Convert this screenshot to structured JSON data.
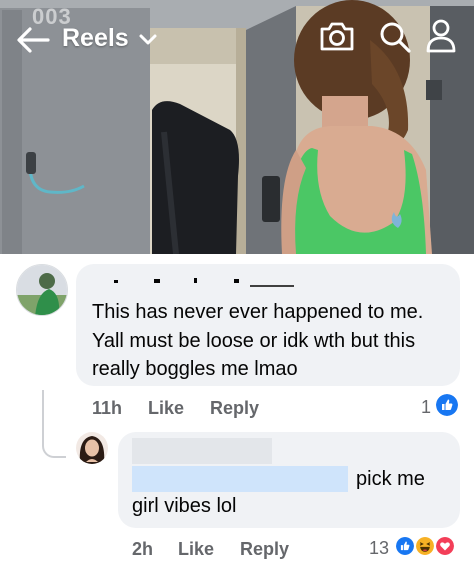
{
  "overlay": {
    "watermark": "003"
  },
  "header": {
    "title": "Reels",
    "icons": [
      "back-arrow-icon",
      "chevron-down-icon",
      "camera-icon",
      "search-icon",
      "profile-icon"
    ]
  },
  "comments": [
    {
      "text": "This has never ever happened to me. Yall must be loose or idk wth but this really boggles me lmao",
      "time": "11h",
      "like_label": "Like",
      "reply_label": "Reply",
      "reaction_count": "1",
      "reactions": [
        "like-reaction-icon"
      ]
    },
    {
      "text_line1": "pick me",
      "text_line2": "girl vibes lol",
      "time": "2h",
      "like_label": "Like",
      "reply_label": "Reply",
      "reaction_count": "13",
      "reactions": [
        "like-reaction-icon",
        "haha-reaction-icon",
        "love-reaction-icon"
      ]
    }
  ],
  "colors": {
    "bubble": "#f0f2f5",
    "meta_text": "#65676b",
    "like_blue": "#1877f2",
    "love_red": "#f33e58",
    "haha_yellow": "#f7b125"
  }
}
